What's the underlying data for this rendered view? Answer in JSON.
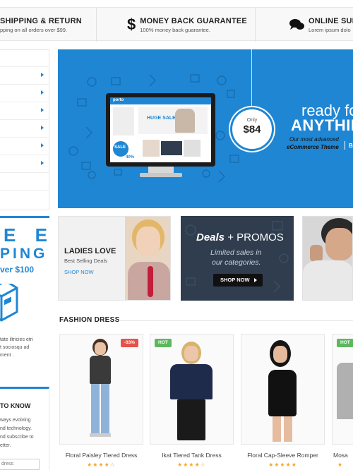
{
  "info_bar": {
    "shipping_title": "SHIPPING & RETURN",
    "shipping_sub": "pping on all orders over $99.",
    "money_icon": "$",
    "money_title": "MONEY BACK GUARANTEE",
    "money_sub": "100% money back guarantee.",
    "support_title": "ONLINE SUPP",
    "support_sub": "Lorem ipsum dolo"
  },
  "hero": {
    "price_label": "Only",
    "price_value": "$84",
    "headline_1": "ready fo",
    "headline_2": "ANYTHIN",
    "sub_1": "Our most advanced",
    "sub_2": "eCommerce Theme",
    "sub_more": "B",
    "screen_logo": "porto",
    "screen_sale": "HUGE SALE",
    "screen_badge": "SALE",
    "screen_badge_pct": "40%"
  },
  "banners": {
    "ladies_title": "LADIES LOVE",
    "ladies_sub": "Best Selling Deals",
    "ladies_link": "SHOP NOW",
    "deals_title": "Deals",
    "deals_plus": "+ PROMOS",
    "deals_line1": "Limited sales in",
    "deals_line2": "our categories.",
    "deals_button": "SHOP NOW"
  },
  "promo": {
    "big_e": "E E",
    "ping": "PING",
    "over": "ver $100",
    "text_1": "tate iltricies etri",
    "text_2": "t sociosqu ad",
    "text_3": "ment ."
  },
  "newsletter": {
    "title": "TO KNOW",
    "line_1": "ways evolving",
    "line_2": "nd technology.",
    "line_3": "nd subscribe to",
    "line_4": "etter.",
    "input_placeholder": "dress"
  },
  "section": {
    "title": "FASHION DRESS"
  },
  "products": [
    {
      "name": "Floral Paisley Tiered Dress",
      "badge": "-33%",
      "badge_color": "#e5534b",
      "stars": "★★★★☆"
    },
    {
      "name": "Ikat Tiered Tank Dress",
      "badge": "HOT",
      "badge_color": "#5cb85c",
      "stars": "★★★★☆"
    },
    {
      "name": "Floral Cap-Sleeve Romper",
      "badge": "",
      "badge_color": "",
      "stars": "★★★★★"
    },
    {
      "name": "Mosa",
      "badge": "HOT",
      "badge_color": "#5cb85c",
      "stars": "★"
    }
  ],
  "colors": {
    "accent": "#1f86d4",
    "dark_banner": "#2f3d4e",
    "star": "#f5a623"
  }
}
